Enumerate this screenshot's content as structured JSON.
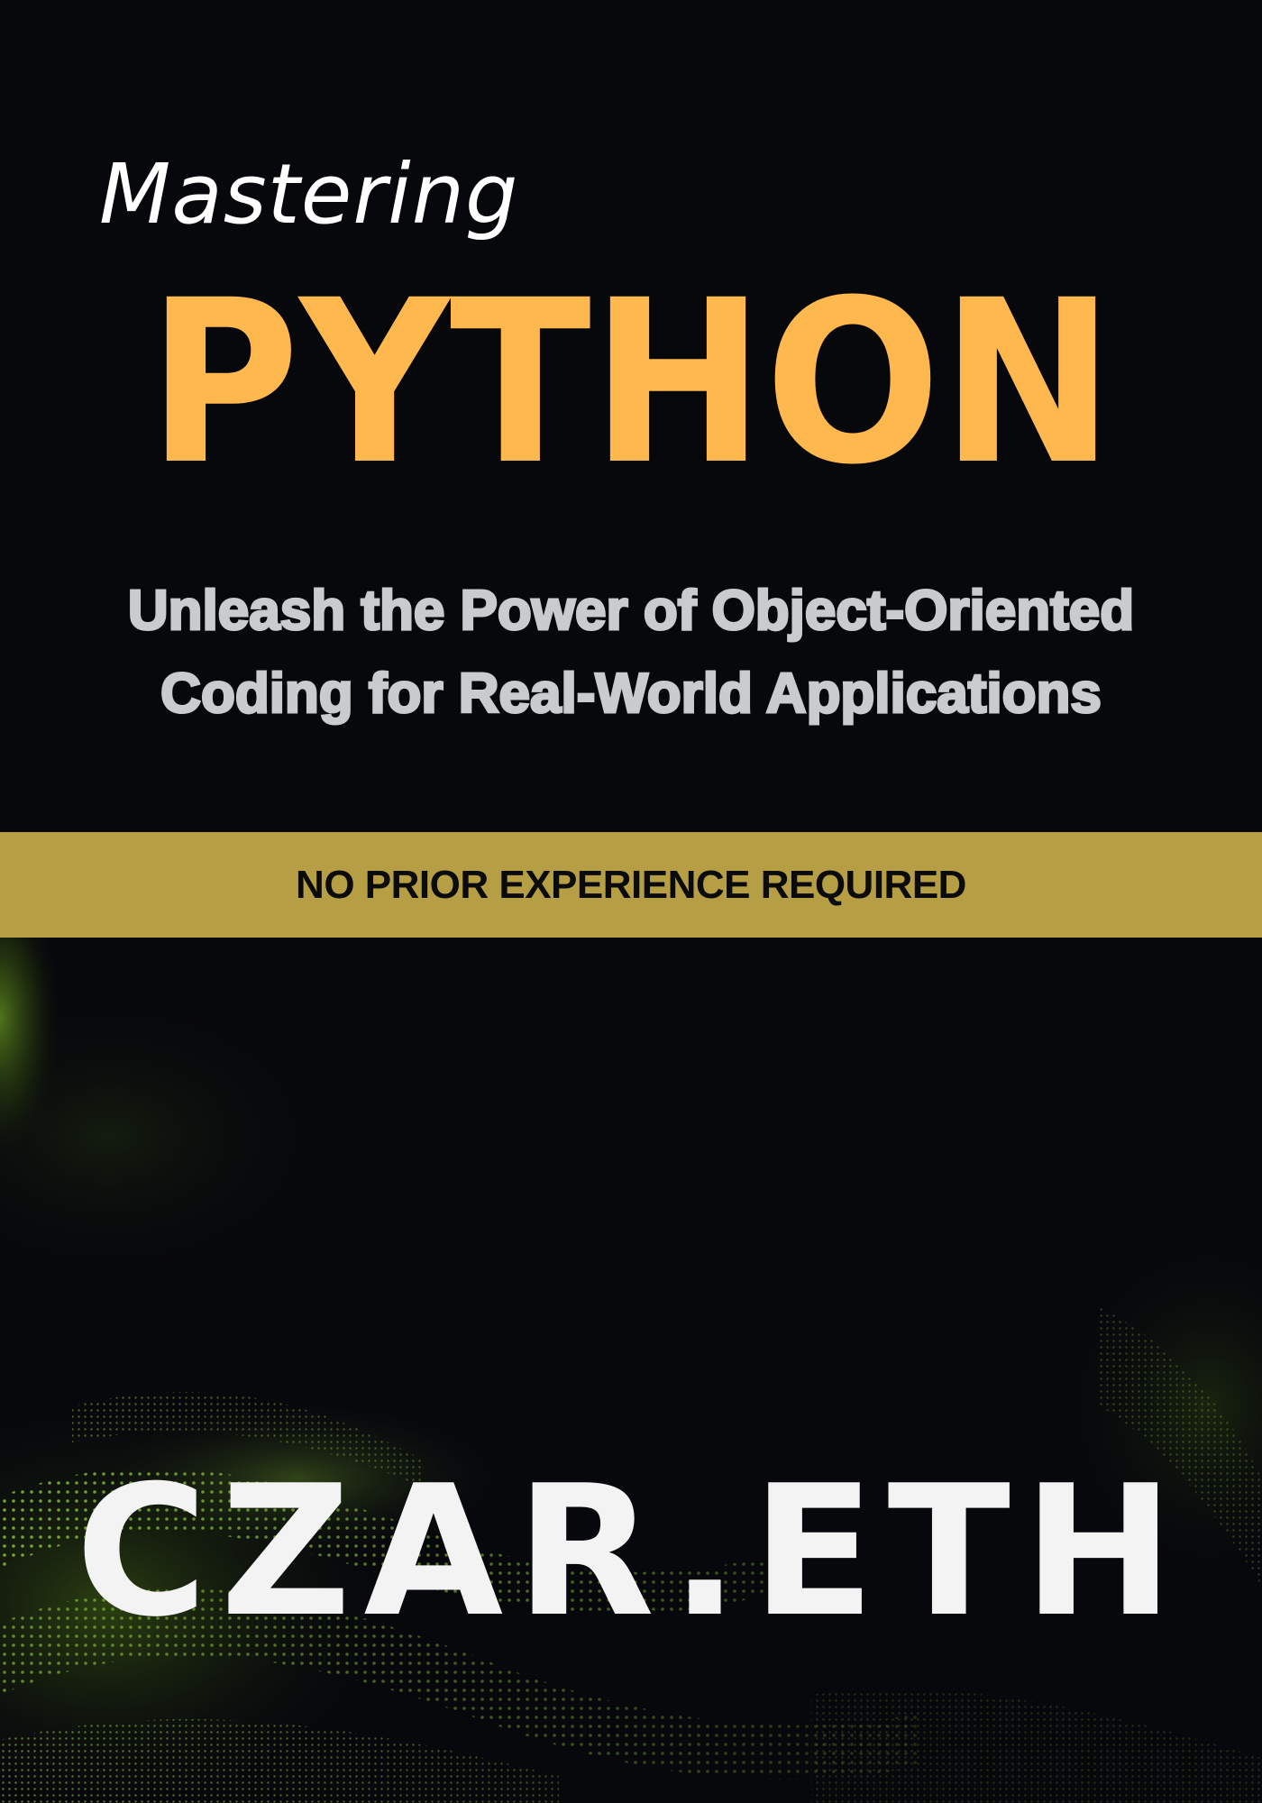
{
  "cover": {
    "kicker": "Mastering",
    "title": "PYTHON",
    "subtitle_line1": "Unleash the Power of Object-Oriented",
    "subtitle_line2": "Coding for Real-World Applications",
    "banner": "NO PRIOR EXPERIENCE REQUIRED",
    "author": "CZAR.ETH"
  },
  "colors": {
    "background": "#07080c",
    "title": "#ffb84d",
    "subtitle": "#c9cbcc",
    "banner_bg": "#b59e44",
    "banner_text": "#0b0b0b",
    "author": "#f3f3f3",
    "glow": "#8fd12a"
  },
  "decoration": {
    "background_art": "green-particle-wave"
  }
}
